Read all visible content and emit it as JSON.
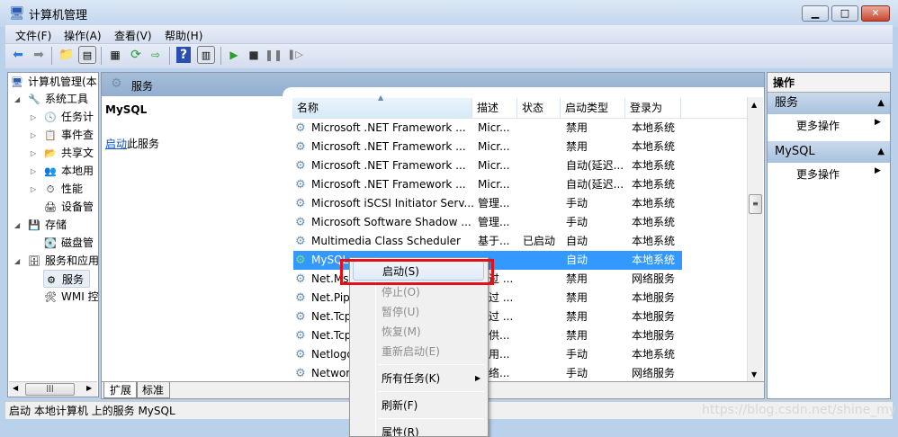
{
  "window": {
    "title": "计算机管理",
    "minimize": "▁",
    "maximize": "□",
    "close": "✕"
  },
  "menu": [
    "文件(F)",
    "操作(A)",
    "查看(V)",
    "帮助(H)"
  ],
  "tree": {
    "root": "计算机管理(本",
    "items": [
      {
        "label": "系统工具",
        "level": 1,
        "expanded": true
      },
      {
        "label": "任务计",
        "level": 2
      },
      {
        "label": "事件查",
        "level": 2
      },
      {
        "label": "共享文",
        "level": 2
      },
      {
        "label": "本地用",
        "level": 2
      },
      {
        "label": "性能",
        "level": 2
      },
      {
        "label": "设备管",
        "level": 2
      },
      {
        "label": "存储",
        "level": 1,
        "expanded": true
      },
      {
        "label": "磁盘管",
        "level": 2
      },
      {
        "label": "服务和应用",
        "level": 1,
        "expanded": true
      },
      {
        "label": "服务",
        "level": 2,
        "selected": true
      },
      {
        "label": "WMI 控",
        "level": 2
      }
    ]
  },
  "middle": {
    "header": "服务",
    "service_name": "MySQL",
    "start_link": "启动",
    "start_suffix": "此服务",
    "columns": [
      "名称",
      "描述",
      "状态",
      "启动类型",
      "登录为"
    ],
    "rows": [
      [
        "Microsoft .NET Framework ...",
        "Micr...",
        "",
        "禁用",
        "本地系统"
      ],
      [
        "Microsoft .NET Framework ...",
        "Micr...",
        "",
        "禁用",
        "本地系统"
      ],
      [
        "Microsoft .NET Framework ...",
        "Micr...",
        "",
        "自动(延迟...",
        "本地系统"
      ],
      [
        "Microsoft .NET Framework ...",
        "Micr...",
        "",
        "自动(延迟...",
        "本地系统"
      ],
      [
        "Microsoft iSCSI Initiator Serv...",
        "管理...",
        "",
        "手动",
        "本地系统"
      ],
      [
        "Microsoft Software Shadow ...",
        "管理...",
        "",
        "手动",
        "本地系统"
      ],
      [
        "Multimedia Class Scheduler",
        "基于...",
        "已启动",
        "自动",
        "本地系统"
      ],
      [
        "MySQL",
        "",
        "",
        "自动",
        "本地系统"
      ],
      [
        "Net.Msmq Listener Adapter",
        "通过 ...",
        "",
        "禁用",
        "网络服务"
      ],
      [
        "Net.Pipe Listener Adapter",
        "通过 ...",
        "",
        "禁用",
        "本地服务"
      ],
      [
        "Net.Tcp Listener Adapter",
        "通过 ...",
        "",
        "禁用",
        "本地服务"
      ],
      [
        "Net.Tcp Port Sharing Service",
        "提供...",
        "",
        "禁用",
        "本地服务"
      ],
      [
        "Netlogon",
        "为用...",
        "",
        "手动",
        "本地系统"
      ],
      [
        "Network Access Protection...",
        "网络...",
        "",
        "手动",
        "网络服务"
      ]
    ],
    "selected_row": 7,
    "tabs": [
      "扩展",
      "标准"
    ]
  },
  "actions": {
    "title": "操作",
    "sections": [
      {
        "header": "服务",
        "item": "更多操作"
      },
      {
        "header": "MySQL",
        "item": "更多操作"
      }
    ]
  },
  "context_menu": {
    "items": [
      {
        "label": "启动(S)",
        "enabled": true
      },
      {
        "label": "停止(O)",
        "enabled": false
      },
      {
        "label": "暂停(U)",
        "enabled": false
      },
      {
        "label": "恢复(M)",
        "enabled": false
      },
      {
        "label": "重新启动(E)",
        "enabled": false
      },
      {
        "label": "所有任务(K)",
        "enabled": true
      },
      {
        "label": "刷新(F)",
        "enabled": true
      },
      {
        "label": "属性(R)",
        "enabled": true
      }
    ]
  },
  "status": "启动 本地计算机 上的服务 MySQL",
  "watermark": "https://blog.csdn.net/shine_my"
}
